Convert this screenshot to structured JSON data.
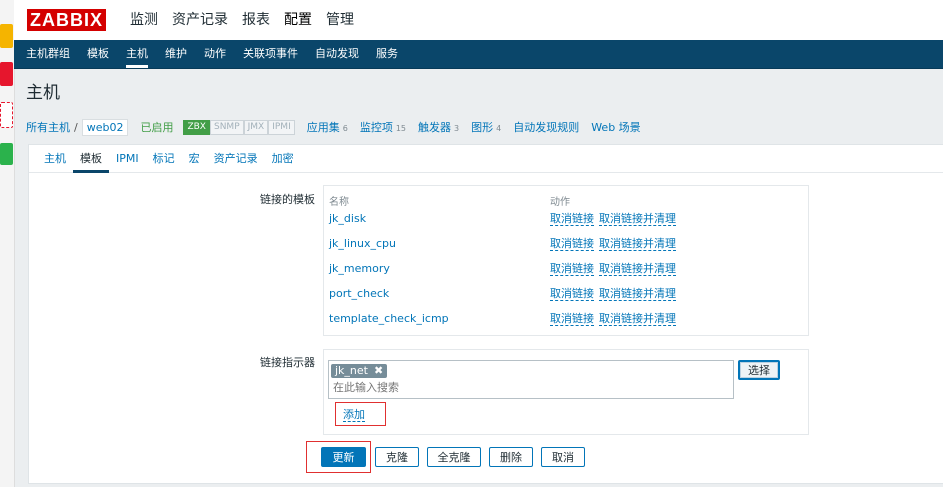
{
  "brand": {
    "logo": "ZABBIX",
    "color": "#d40000"
  },
  "top_menu": [
    {
      "label": "监测",
      "active": false
    },
    {
      "label": "资产记录",
      "active": false
    },
    {
      "label": "报表",
      "active": false
    },
    {
      "label": "配置",
      "active": true
    },
    {
      "label": "管理",
      "active": false
    }
  ],
  "sub_menu": [
    {
      "label": "主机群组",
      "active": false
    },
    {
      "label": "模板",
      "active": false
    },
    {
      "label": "主机",
      "active": true
    },
    {
      "label": "维护",
      "active": false
    },
    {
      "label": "动作",
      "active": false
    },
    {
      "label": "关联项事件",
      "active": false
    },
    {
      "label": "自动发现",
      "active": false
    },
    {
      "label": "服务",
      "active": false
    }
  ],
  "page_title": "主机",
  "host_bar": {
    "all_hosts": "所有主机",
    "separator": "/",
    "host_name": "web02",
    "status": "已启用",
    "interfaces": [
      {
        "label": "ZBX",
        "on": true
      },
      {
        "label": "SNMP",
        "on": false
      },
      {
        "label": "JMX",
        "on": false
      },
      {
        "label": "IPMI",
        "on": false
      }
    ],
    "links": [
      {
        "label": "应用集",
        "count": "6"
      },
      {
        "label": "监控项",
        "count": "15"
      },
      {
        "label": "触发器",
        "count": "3"
      },
      {
        "label": "图形",
        "count": "4"
      },
      {
        "label": "自动发现规则",
        "count": ""
      },
      {
        "label": "Web 场景",
        "count": ""
      }
    ]
  },
  "tabs": [
    {
      "label": "主机",
      "active": false
    },
    {
      "label": "模板",
      "active": true
    },
    {
      "label": "IPMI",
      "active": false
    },
    {
      "label": "标记",
      "active": false
    },
    {
      "label": "宏",
      "active": false
    },
    {
      "label": "资产记录",
      "active": false
    },
    {
      "label": "加密",
      "active": false
    }
  ],
  "linked_templates": {
    "label": "链接的模板",
    "col_name": "名称",
    "col_action": "动作",
    "unlink_label": "取消链接",
    "unlink_clear_label": "取消链接并清理",
    "rows": [
      {
        "name": "jk_disk"
      },
      {
        "name": "jk_linux_cpu"
      },
      {
        "name": "jk_memory"
      },
      {
        "name": "port_check"
      },
      {
        "name": "template_check_icmp"
      }
    ]
  },
  "link_indicator": {
    "label": "链接指示器",
    "chip": "jk_net",
    "chip_remove": "✖",
    "placeholder": "在此输入搜索",
    "select_label": "选择",
    "add_label": "添加"
  },
  "buttons": {
    "update": "更新",
    "clone": "克隆",
    "full_clone": "全克隆",
    "delete": "删除",
    "cancel": "取消"
  },
  "colors": {
    "nav_blue": "#0a466a",
    "link_blue": "#0275b8",
    "enabled_green": "#429e47",
    "highlight_red": "#e03030"
  }
}
